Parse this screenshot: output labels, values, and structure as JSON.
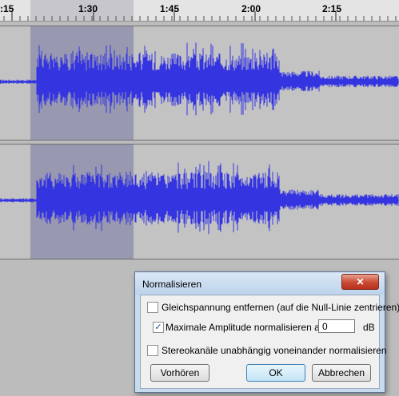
{
  "ruler": {
    "labels": [
      ":15",
      "1:30",
      "1:45",
      "2:00",
      "2:15"
    ]
  },
  "colors": {
    "waveform": "#3434e0",
    "selection": "#9898b0",
    "track_background": "#c3c3c3"
  },
  "dialog": {
    "title": "Normalisieren",
    "close_glyph": "✕",
    "options": {
      "remove_dc": {
        "label": "Gleichspannung entfernen (auf die Null-Linie zentrieren)",
        "checked": false
      },
      "normalize_max": {
        "label": "Maximale Amplitude normalisieren auf",
        "checked": true,
        "value": "0",
        "unit": "dB"
      },
      "stereo_independent": {
        "label": "Stereokanäle unabhängig voneinander normalisieren",
        "checked": false
      }
    },
    "buttons": {
      "preview": "Vorhören",
      "ok": "OK",
      "cancel": "Abbrechen"
    }
  }
}
